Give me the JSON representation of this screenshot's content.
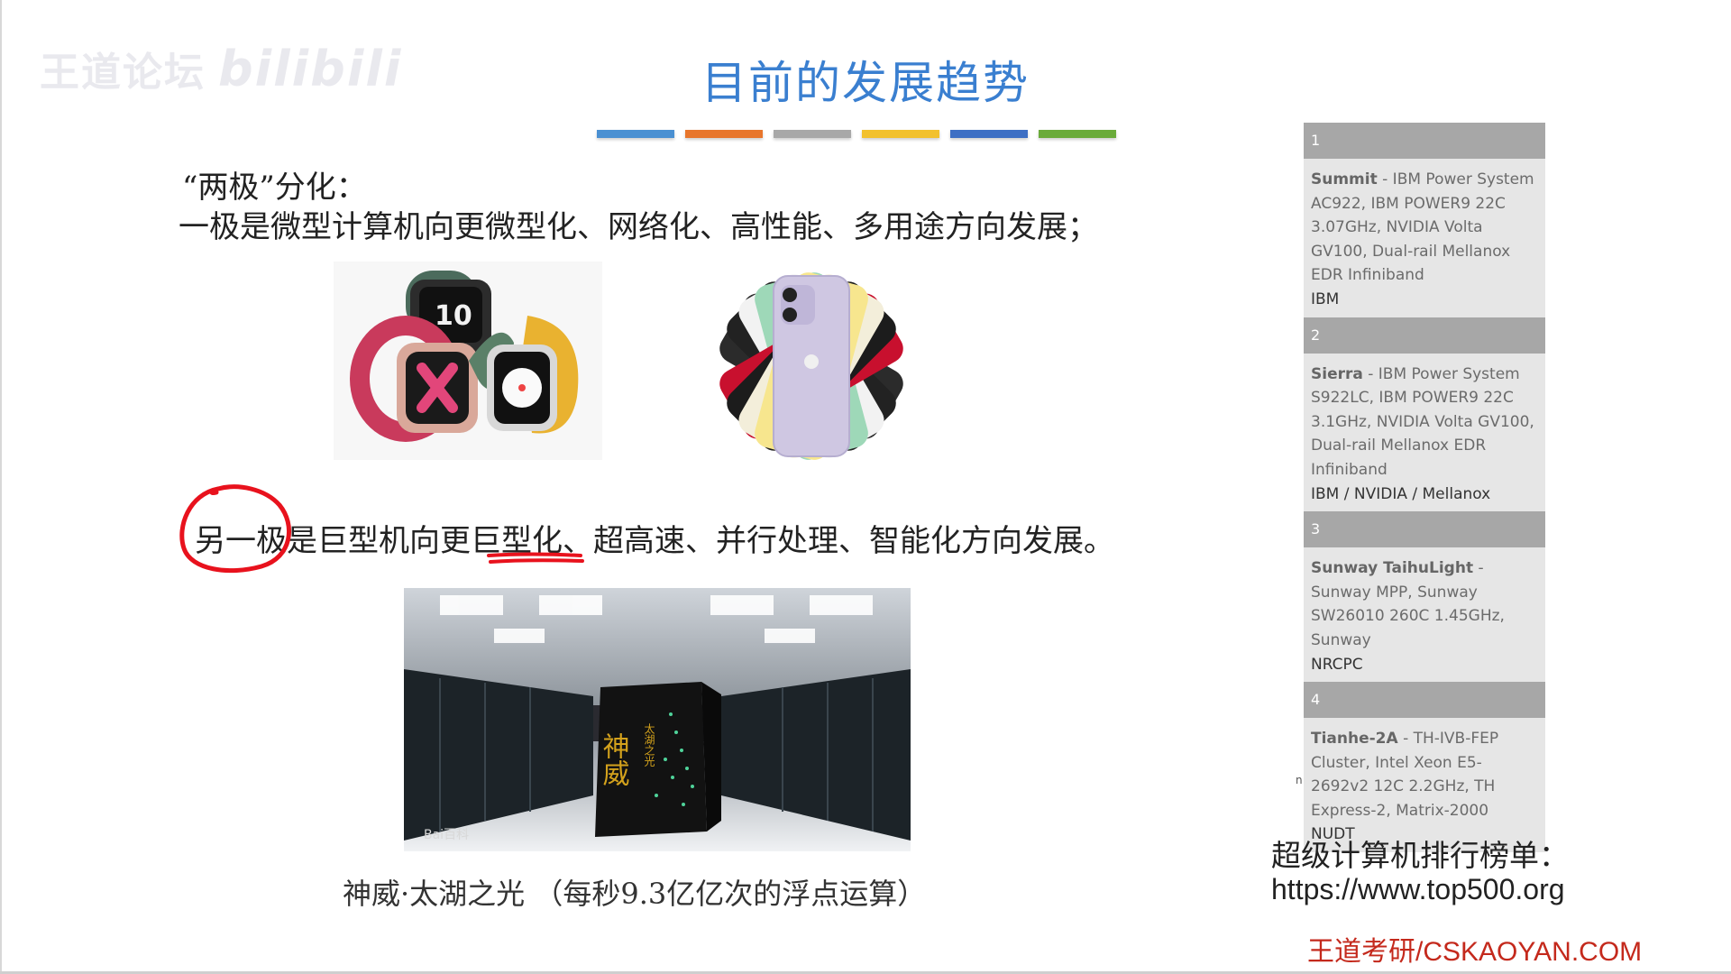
{
  "watermark": {
    "channel": "王道论坛",
    "brand": "bilibili"
  },
  "slide": {
    "title": "目前的发展趋势",
    "bar_colors": [
      "#4a90d2",
      "#e8762c",
      "#a8a8a8",
      "#f2c12e",
      "#3d6fc4",
      "#6aab3a"
    ],
    "line1": "“两极”分化：",
    "line2": "一极是微型计算机向更微型化、网络化、高性能、多用途方向发展；",
    "line3": "另一极是巨型机向更巨型化、超高速、并行处理、智能化方向发展。",
    "super_caption": "神威·太湖之光 （每秒9.3亿亿次的浮点运算）",
    "super_sign": "神威",
    "super_sign_sub": "太湖之光",
    "baidu_mark": "Bai百科"
  },
  "ranking": {
    "entries": [
      {
        "rank": "1",
        "name": "Summit",
        "desc": " - IBM Power System AC922, IBM POWER9 22C 3.07GHz, NVIDIA Volta GV100, Dual-rail Mellanox EDR Infiniband",
        "org": "IBM"
      },
      {
        "rank": "2",
        "name": "Sierra",
        "desc": " - IBM Power System S922LC, IBM POWER9 22C 3.1GHz, NVIDIA Volta GV100, Dual-rail Mellanox EDR Infiniband",
        "org": "IBM / NVIDIA / Mellanox"
      },
      {
        "rank": "3",
        "name": "Sunway TaihuLight",
        "desc": " - Sunway MPP, Sunway SW26010 260C 1.45GHz, Sunway",
        "org": "NRCPC"
      },
      {
        "rank": "4",
        "name": "Tianhe-2A",
        "desc": " - TH-IVB-FEP Cluster, Intel Xeon E5-2692v2 12C 2.2GHz, TH Express-2, Matrix-2000",
        "org": "NUDT"
      }
    ],
    "caption": "超级计算机排行榜单：",
    "url": "https://www.top500.org"
  },
  "footer": {
    "brand": "王道考研/CSKAOYAN.COM"
  }
}
